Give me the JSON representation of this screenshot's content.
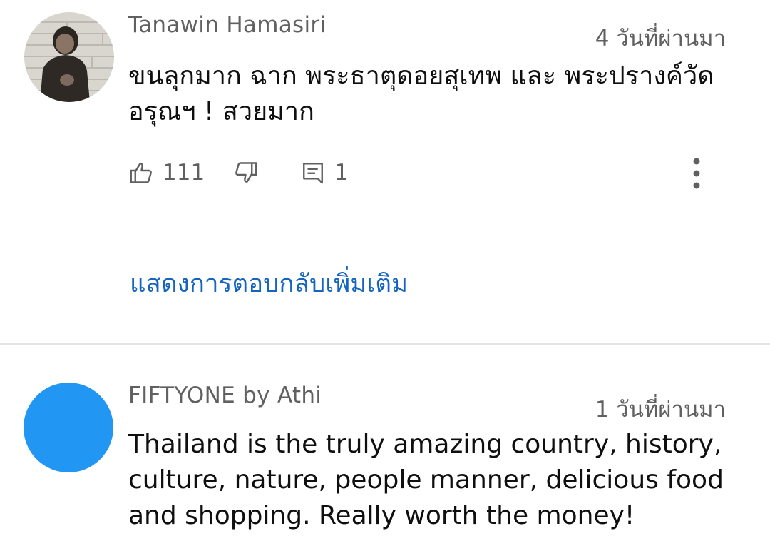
{
  "comments": [
    {
      "author": "Tanawin Hamasiri",
      "time": "4 วันที่ผ่านมา",
      "text": "ขนลุกมาก ฉาก พระธาตุดอยสุเทพ และ พระปรางค์วัดอรุณฯ ! สวยมาก",
      "likes": "111",
      "replies": "1",
      "show_more_replies": "แสดงการตอบกลับเพิ่มเติม"
    },
    {
      "author": "FIFTYONE by Athi",
      "time": "1 วันที่ผ่านมา",
      "text": "Thailand is the truly amazing country, history, culture, nature, people manner, delicious food and shopping. Really worth the money!",
      "avatar_color": "#2196f3"
    }
  ],
  "icons": {
    "like": "thumbs-up-icon",
    "dislike": "thumbs-down-icon",
    "reply": "reply-icon",
    "more": "more-vert-icon"
  }
}
